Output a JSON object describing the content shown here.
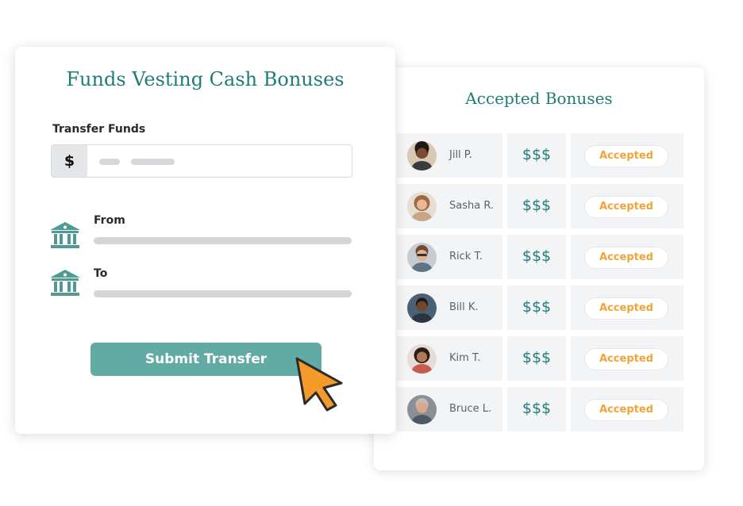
{
  "funds_card": {
    "title": "Funds Vesting Cash Bonuses",
    "transfer_label": "Transfer Funds",
    "currency_symbol": "$",
    "from_label": "From",
    "to_label": "To",
    "submit_label": "Submit Transfer"
  },
  "bonuses_card": {
    "title": "Accepted Bonuses",
    "rows": [
      {
        "name": "Jill P.",
        "amount": "$$$",
        "status": "Accepted"
      },
      {
        "name": "Sasha R.",
        "amount": "$$$",
        "status": "Accepted"
      },
      {
        "name": "Rick T.",
        "amount": "$$$",
        "status": "Accepted"
      },
      {
        "name": "Bill K.",
        "amount": "$$$",
        "status": "Accepted"
      },
      {
        "name": "Kim T.",
        "amount": "$$$",
        "status": "Accepted"
      },
      {
        "name": "Bruce L.",
        "amount": "$$$",
        "status": "Accepted"
      }
    ]
  },
  "colors": {
    "teal": "#1f7d78",
    "button": "#62aaa4",
    "accepted": "#f2a33a",
    "cursor": "#f39a2b"
  },
  "icons": {
    "bank": "bank-icon",
    "cursor": "cursor-arrow-icon",
    "avatar": "avatar"
  }
}
